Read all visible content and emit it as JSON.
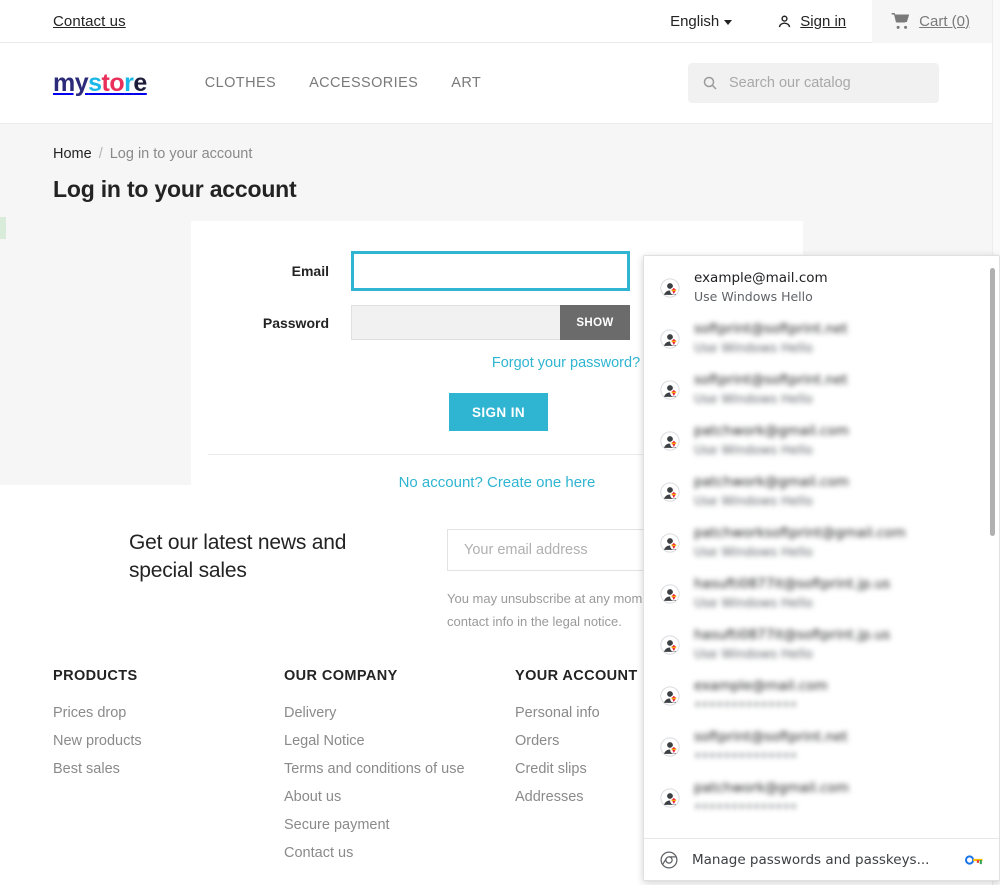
{
  "topbar": {
    "contact_label": "Contact us",
    "language": "English",
    "signin_label": "Sign in",
    "cart_label": "Cart (0)"
  },
  "header": {
    "logo": {
      "part1": "my",
      "part2": "s",
      "part3": "to",
      "part4": "r",
      "part5": "e"
    },
    "nav": [
      {
        "label": "CLOTHES"
      },
      {
        "label": "ACCESSORIES"
      },
      {
        "label": "ART"
      }
    ],
    "search": {
      "placeholder": "Search our catalog",
      "value": "",
      "icon": "search-icon"
    }
  },
  "breadcrumb": {
    "home": "Home",
    "separator": "/",
    "current": "Log in to your account"
  },
  "page_title": "Log in to your account",
  "login_form": {
    "email_label": "Email",
    "email_value": "",
    "password_label": "Password",
    "password_value": "",
    "show_label": "SHOW",
    "forgot_label": "Forgot your password?",
    "signin_button": "SIGN IN",
    "create_account": "No account? Create one here"
  },
  "newsletter": {
    "title": "Get our latest news and special sales",
    "input_placeholder": "Your email address",
    "input_value": "",
    "note": "You may unsubscribe at any moment. Find the contact info in the legal notice."
  },
  "footer": {
    "columns": [
      {
        "heading": "PRODUCTS",
        "links": [
          "Prices drop",
          "New products",
          "Best sales"
        ]
      },
      {
        "heading": "OUR COMPANY",
        "links": [
          "Delivery",
          "Legal Notice",
          "Terms and conditions of use",
          "About us",
          "Secure payment",
          "Contact us"
        ]
      },
      {
        "heading": "YOUR ACCOUNT",
        "links": [
          "Personal info",
          "Orders",
          "Credit slips",
          "Addresses"
        ]
      }
    ]
  },
  "autofill_dropdown": {
    "items": [
      {
        "username": "example@mail.com",
        "sub": "Use Windows Hello",
        "blurred": false
      },
      {
        "username": "softprint@softprint.net",
        "sub": "Use Windows Hello",
        "blurred": true
      },
      {
        "username": "softprint@softprint.net",
        "sub": "Use Windows Hello",
        "blurred": true
      },
      {
        "username": "patchwork@gmail.com",
        "sub": "Use Windows Hello",
        "blurred": true
      },
      {
        "username": "patchwork@gmail.com",
        "sub": "Use Windows Hello",
        "blurred": true
      },
      {
        "username": "patchworksoftprint@gmail.com",
        "sub": "Use Windows Hello",
        "blurred": true
      },
      {
        "username": "hasufti0877it@softprint.jp.us",
        "sub": "Use Windows Hello",
        "blurred": true
      },
      {
        "username": "hasufti0877it@softprint.jp.us",
        "sub": "Use Windows Hello",
        "blurred": true
      },
      {
        "username": "example@mail.com",
        "sub": "••••••••••••••",
        "blurred": true
      },
      {
        "username": "softprint@softprint.net",
        "sub": "••••••••••••••",
        "blurred": true
      },
      {
        "username": "patchwork@gmail.com",
        "sub": "••••••••••••••",
        "blurred": true
      }
    ],
    "footer_label": "Manage passwords and passkeys...",
    "footer_icon": "chrome-icon",
    "footer_key_icon": "key-icon"
  },
  "colors": {
    "accent": "#2fb5d2",
    "logo_blue": "#2b2b7a",
    "logo_cyan": "#1ab8e8",
    "logo_red": "#e8305a",
    "page_bg": "#f6f6f6",
    "show_button": "#6b6b6b"
  }
}
